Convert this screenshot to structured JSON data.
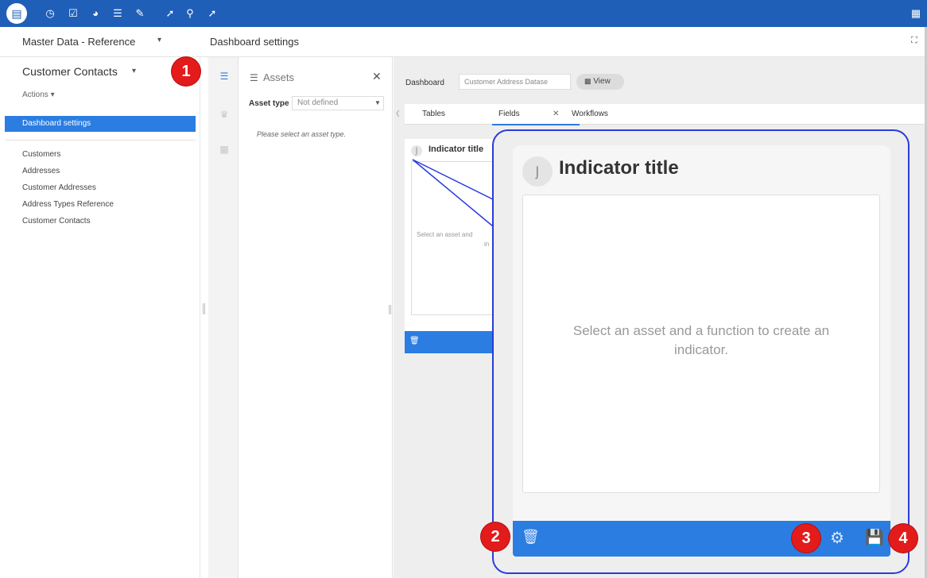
{
  "toolbar": {
    "icons": [
      "database-icon",
      "clock-icon",
      "checklist-icon",
      "gauge-icon",
      "document-icon",
      "edit-check-icon",
      "pin-icon",
      "search-icon",
      "wrench-icon"
    ],
    "right_icon": "grid-icon"
  },
  "header": {
    "app_name": "Master Data - Reference",
    "page_title": "Dashboard settings"
  },
  "sidebar": {
    "title": "Customer Contacts",
    "actions_label": "Actions ▾",
    "selected_item": "Dashboard settings",
    "items": [
      {
        "label": "Customers"
      },
      {
        "label": "Addresses"
      },
      {
        "label": "Customer Addresses"
      },
      {
        "label": "Address Types Reference"
      },
      {
        "label": "Customer Contacts"
      }
    ]
  },
  "assets_panel": {
    "title": "Assets",
    "asset_type_label": "Asset type",
    "asset_type_value": "Not defined",
    "hint": "Please select an asset type."
  },
  "dashboard": {
    "label": "Dashboard",
    "select_value": "Customer Address Datase",
    "view_button": "View",
    "tabs": [
      {
        "label": "Tables"
      },
      {
        "label": "Fields"
      },
      {
        "label": "Workflows"
      }
    ]
  },
  "indicator": {
    "title": "Indicator title",
    "placeholder": "Select an asset and a function to create an indicator.",
    "small_placeholder_1": "Select an asset and",
    "small_placeholder_2": "in"
  },
  "markers": [
    "1",
    "2",
    "3",
    "4"
  ],
  "colors": {
    "toolbar": "#1f5fb8",
    "accent": "#2b7de1",
    "marker": "#e31b1b",
    "callout": "#2a3bdc"
  }
}
